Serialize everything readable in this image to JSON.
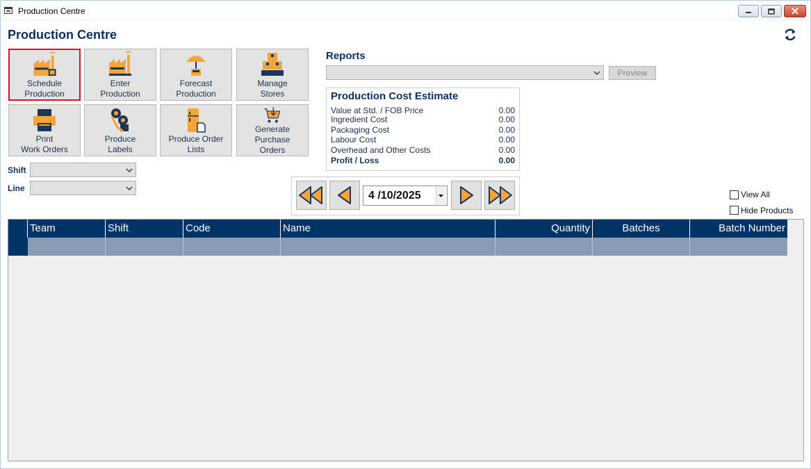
{
  "window": {
    "title": "Production Centre"
  },
  "page_title": "Production Centre",
  "tiles": [
    {
      "label": "Schedule\nProduction",
      "icon": "factory-schedule-icon"
    },
    {
      "label": "Enter\nProduction",
      "icon": "factory-icon"
    },
    {
      "label": "Forecast\nProduction",
      "icon": "umbrella-forecast-icon"
    },
    {
      "label": "Manage\nStores",
      "icon": "boxes-stores-icon"
    },
    {
      "label": "Print\nWork Orders",
      "icon": "printer-icon"
    },
    {
      "label": "Produce\nLabels",
      "icon": "label-rolls-icon"
    },
    {
      "label": "Produce Order\nLists",
      "icon": "fridge-list-icon"
    },
    {
      "label": "Generate Purchase\nOrders",
      "icon": "shopping-cart-icon"
    }
  ],
  "filters": {
    "shift_label": "Shift",
    "shift_value": "",
    "line_label": "Line",
    "line_value": ""
  },
  "reports": {
    "label": "Reports",
    "selected": "",
    "preview_label": "Preview"
  },
  "cost_estimate": {
    "title": "Production Cost Estimate",
    "rows": [
      {
        "label": "Value at Std. / FOB Price",
        "value": "0.00"
      },
      {
        "label": "Ingredient Cost",
        "value": "0.00"
      },
      {
        "label": "Packaging Cost",
        "value": "0.00"
      },
      {
        "label": "Labour Cost",
        "value": "0.00"
      },
      {
        "label": "Overhead and Other Costs",
        "value": "0.00"
      },
      {
        "label": "Profit / Loss",
        "value": "0.00"
      }
    ]
  },
  "date_nav": {
    "date": "4 /10/2025"
  },
  "options": {
    "view_all_label": "View All",
    "view_all_checked": false,
    "hide_products_label": "Hide Products",
    "hide_products_checked": false
  },
  "grid": {
    "columns": [
      "Team",
      "Shift",
      "Code",
      "Name",
      "Quantity",
      "Batches",
      "Batch Number"
    ],
    "rows": [
      [
        "",
        "",
        "",
        "",
        "",
        "",
        ""
      ]
    ]
  },
  "colors": {
    "accent": "#003366",
    "title_text": "#0d2f5e",
    "icon_orange": "#f5a43a",
    "icon_navy": "#1d3557",
    "selected_border": "#d4141c",
    "row_fill": "#8a9bb6"
  }
}
